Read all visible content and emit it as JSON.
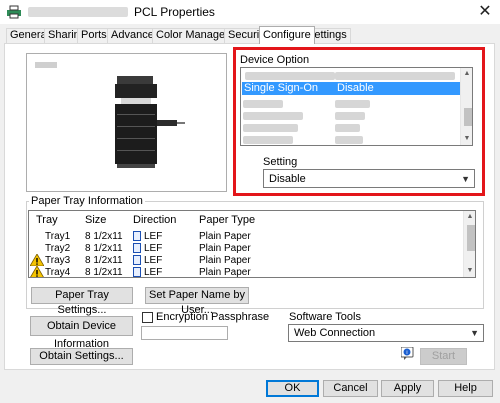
{
  "window": {
    "title": "PCL Properties",
    "close_glyph": "✕"
  },
  "tabs": [
    {
      "label": "General"
    },
    {
      "label": "Sharing"
    },
    {
      "label": "Ports"
    },
    {
      "label": "Advanced"
    },
    {
      "label": "Color Management"
    },
    {
      "label": "Security"
    },
    {
      "label": "Configure"
    },
    {
      "label": "Settings"
    }
  ],
  "active_tab": "Configure",
  "device_option": {
    "group_label": "Device Option",
    "selected_item": {
      "name": "Single Sign-On",
      "value": "Disable"
    },
    "setting_label": "Setting",
    "setting_value": "Disable"
  },
  "paper_tray": {
    "group_label": "Paper Tray Information",
    "columns": [
      "Tray",
      "Size",
      "Direction",
      "Paper Type"
    ],
    "rows": [
      {
        "tray": "Tray1",
        "size": "8 1/2x11",
        "direction": "LEF",
        "type": "Plain Paper",
        "warning": false
      },
      {
        "tray": "Tray2",
        "size": "8 1/2x11",
        "direction": "LEF",
        "type": "Plain Paper",
        "warning": false
      },
      {
        "tray": "Tray3",
        "size": "8 1/2x11",
        "direction": "LEF",
        "type": "Plain Paper",
        "warning": true
      },
      {
        "tray": "Tray4",
        "size": "8 1/2x11",
        "direction": "LEF",
        "type": "Plain Paper",
        "warning": true
      }
    ],
    "paper_tray_settings_button": "Paper Tray Settings...",
    "set_paper_name_button": "Set Paper Name by User..."
  },
  "actions": {
    "obtain_device_info": "Obtain Device Information",
    "obtain_settings": "Obtain Settings...",
    "encryption_label": "Encryption Passphrase",
    "encryption_checked": false,
    "encryption_value": ""
  },
  "software_tools": {
    "label": "Software Tools",
    "selected": "Web Connection",
    "start_button": "Start"
  },
  "footer": {
    "ok": "OK",
    "cancel": "Cancel",
    "apply": "Apply",
    "help": "Help"
  },
  "colors": {
    "highlight": "#e3161a",
    "selection": "#3399ff",
    "default_button_border": "#0078d7"
  }
}
